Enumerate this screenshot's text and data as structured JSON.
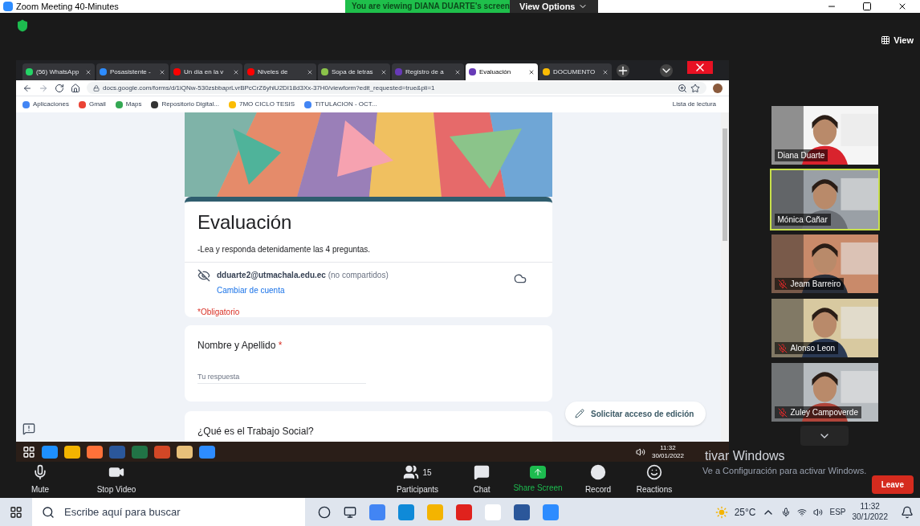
{
  "zoom_window": {
    "title": "Zoom Meeting 40-Minutes",
    "banner": "You are viewing DIANA DUARTE's screen",
    "view_options": "View Options",
    "view_button": "View"
  },
  "browser": {
    "tabs": [
      {
        "label": "(56) WhatsApp",
        "selected": false,
        "color": "#25d366"
      },
      {
        "label": "Posasistente -",
        "selected": false,
        "color": "#2d8cff"
      },
      {
        "label": "Un día en la v",
        "selected": false,
        "color": "#ff0000"
      },
      {
        "label": "Niveles de",
        "selected": false,
        "color": "#ff0000"
      },
      {
        "label": "Sopa de letras",
        "selected": false,
        "color": "#8bc34a"
      },
      {
        "label": "Registro de a",
        "selected": false,
        "color": "#673ab7"
      },
      {
        "label": "Evaluación",
        "selected": true,
        "color": "#673ab7"
      },
      {
        "label": "DOCUMENTO",
        "selected": false,
        "color": "#fbbc04"
      }
    ],
    "url": "docs.google.com/forms/d/1iQNw-530zsbbaprLvrBPcCrZ6yhiU2DI18d3Xx-37H0/viewform?edit_requested=true&pli=1",
    "bookmarks": [
      {
        "label": "Aplicaciones",
        "color": "#4285f4"
      },
      {
        "label": "Gmail",
        "color": "#ea4335"
      },
      {
        "label": "Maps",
        "color": "#34a853"
      },
      {
        "label": "Repositorio Digital...",
        "color": "#333333"
      },
      {
        "label": "7MO CICLO TESIS",
        "color": "#fbbc04"
      },
      {
        "label": "TITULACION - OCT...",
        "color": "#4285f4"
      }
    ],
    "reading_list": "Lista de lectura"
  },
  "form": {
    "title": "Evaluación",
    "description": "-Lea y responda detenidamente las 4 preguntas.",
    "account_email": "dduarte2@utmachala.edu.ec",
    "account_note": "(no compartidos)",
    "switch_account": "Cambiar de cuenta",
    "required_note": "*Obligatorio",
    "questions": [
      {
        "label": "Nombre y Apellido",
        "required_mark": "*",
        "placeholder": "Tu respuesta"
      },
      {
        "label": "¿Qué es el Trabajo Social?"
      }
    ],
    "edit_request_button": "Solicitar acceso de edición"
  },
  "remote_taskbar": {
    "time": "11:32",
    "date": "30/01/2022"
  },
  "activation_notice": {
    "title": "tivar Windows",
    "subtitle": "Ve a Configuración para activar Windows."
  },
  "videos": [
    {
      "name": "Diana Duarte",
      "muted": false,
      "speaking": false
    },
    {
      "name": "Mónica Cañar",
      "muted": false,
      "speaking": true
    },
    {
      "name": "Jeam Barreiro",
      "muted": true,
      "speaking": false
    },
    {
      "name": "Alonso Leon",
      "muted": true,
      "speaking": false
    },
    {
      "name": "Zuley Campoverde",
      "muted": true,
      "speaking": false
    }
  ],
  "meeting_toolbar": {
    "items": [
      {
        "kind": "mic",
        "label": "Mute"
      },
      {
        "kind": "video",
        "label": "Stop Video"
      },
      {
        "kind": "participants",
        "label": "Participants",
        "count": "15"
      },
      {
        "kind": "chat",
        "label": "Chat"
      },
      {
        "kind": "share",
        "label": "Share Screen"
      },
      {
        "kind": "record",
        "label": "Record"
      },
      {
        "kind": "reactions",
        "label": "Reactions"
      }
    ],
    "leave": "Leave"
  },
  "taskbar": {
    "search_placeholder": "Escribe aquí para buscar",
    "temperature": "25°C",
    "language": "ESP",
    "time": "11:32",
    "date": "30/1/2022"
  }
}
